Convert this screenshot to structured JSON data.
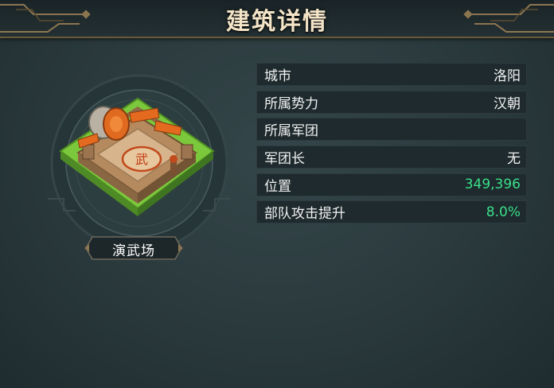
{
  "header": {
    "title": "建筑详情"
  },
  "building": {
    "name": "演武场",
    "icon": "training-ground-building",
    "flag_char": "武"
  },
  "info_rows": [
    {
      "label": "城市",
      "value": "洛阳",
      "highlight": false
    },
    {
      "label": "所属势力",
      "value": "汉朝",
      "highlight": false
    },
    {
      "label": "所属军团",
      "value": "",
      "highlight": false
    },
    {
      "label": "军团长",
      "value": "无",
      "highlight": false
    },
    {
      "label": "位置",
      "value": "349,396",
      "highlight": true
    },
    {
      "label": "部队攻击提升",
      "value": "8.0%",
      "highlight": true
    }
  ],
  "colors": {
    "highlight": "#39e08a",
    "title": "#f3e4c8",
    "frame_gold": "#8b7550"
  }
}
